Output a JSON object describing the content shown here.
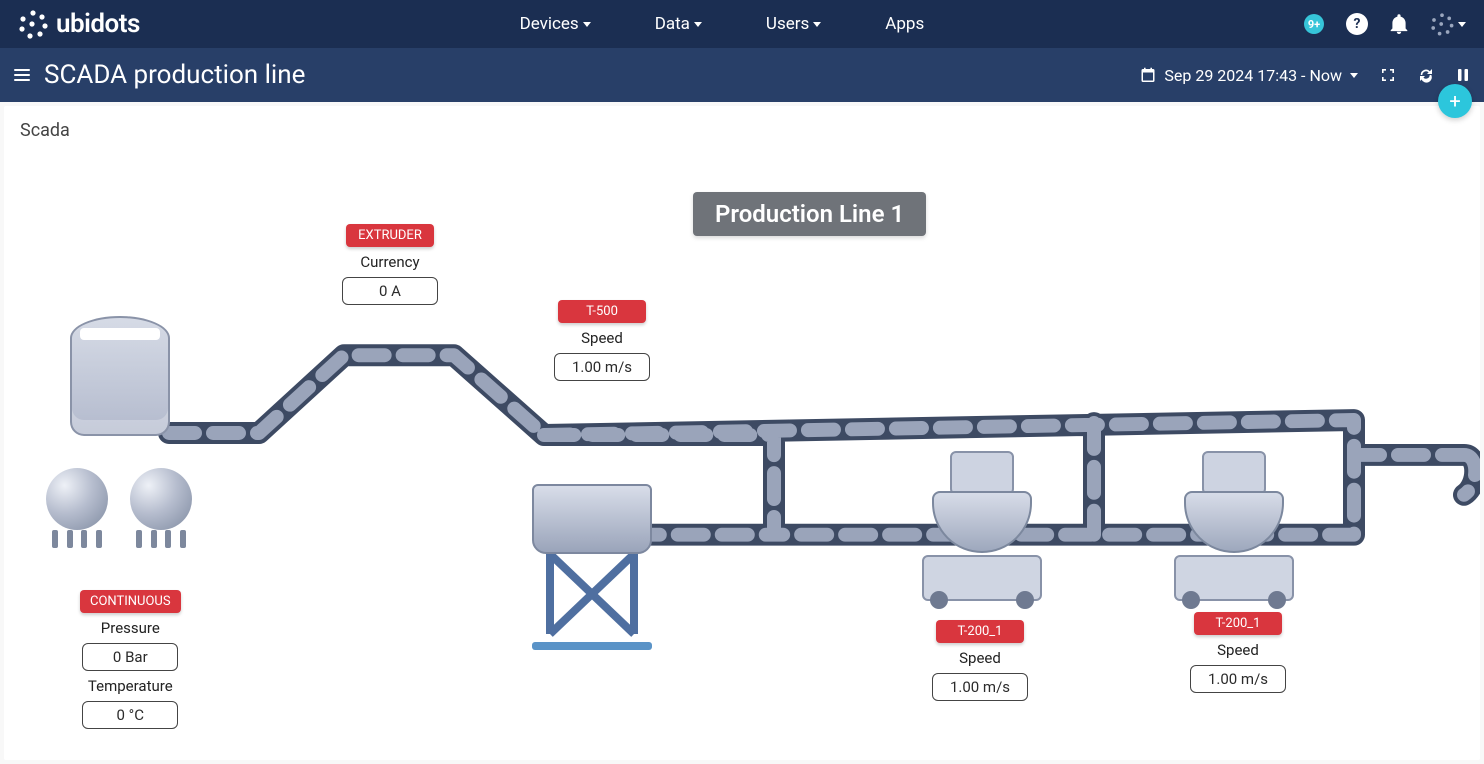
{
  "brand": {
    "name": "ubidots"
  },
  "nav": {
    "devices": "Devices",
    "data": "Data",
    "users": "Users",
    "apps": "Apps",
    "notif_count": "9+"
  },
  "subheader": {
    "title": "SCADA production line",
    "date_range": "Sep 29 2024 17:43 - Now"
  },
  "breadcrumb": "Scada",
  "canvas_title": "Production Line 1",
  "widgets": {
    "extruder": {
      "device": "EXTRUDER",
      "var1_label": "Currency",
      "var1_value": "0 A"
    },
    "t500": {
      "device": "T-500",
      "var1_label": "Speed",
      "var1_value": "1.00  m/s"
    },
    "continuous": {
      "device": "CONTINUOUS",
      "var1_label": "Pressure",
      "var1_value": "0 Bar",
      "var2_label": "Temperature",
      "var2_value": "0 °C"
    },
    "t200_1a": {
      "device": "T-200_1",
      "var1_label": "Speed",
      "var1_value": "1.00  m/s"
    },
    "t200_1b": {
      "device": "T-200_1",
      "var1_label": "Speed",
      "var1_value": "1.00  m/s"
    }
  }
}
